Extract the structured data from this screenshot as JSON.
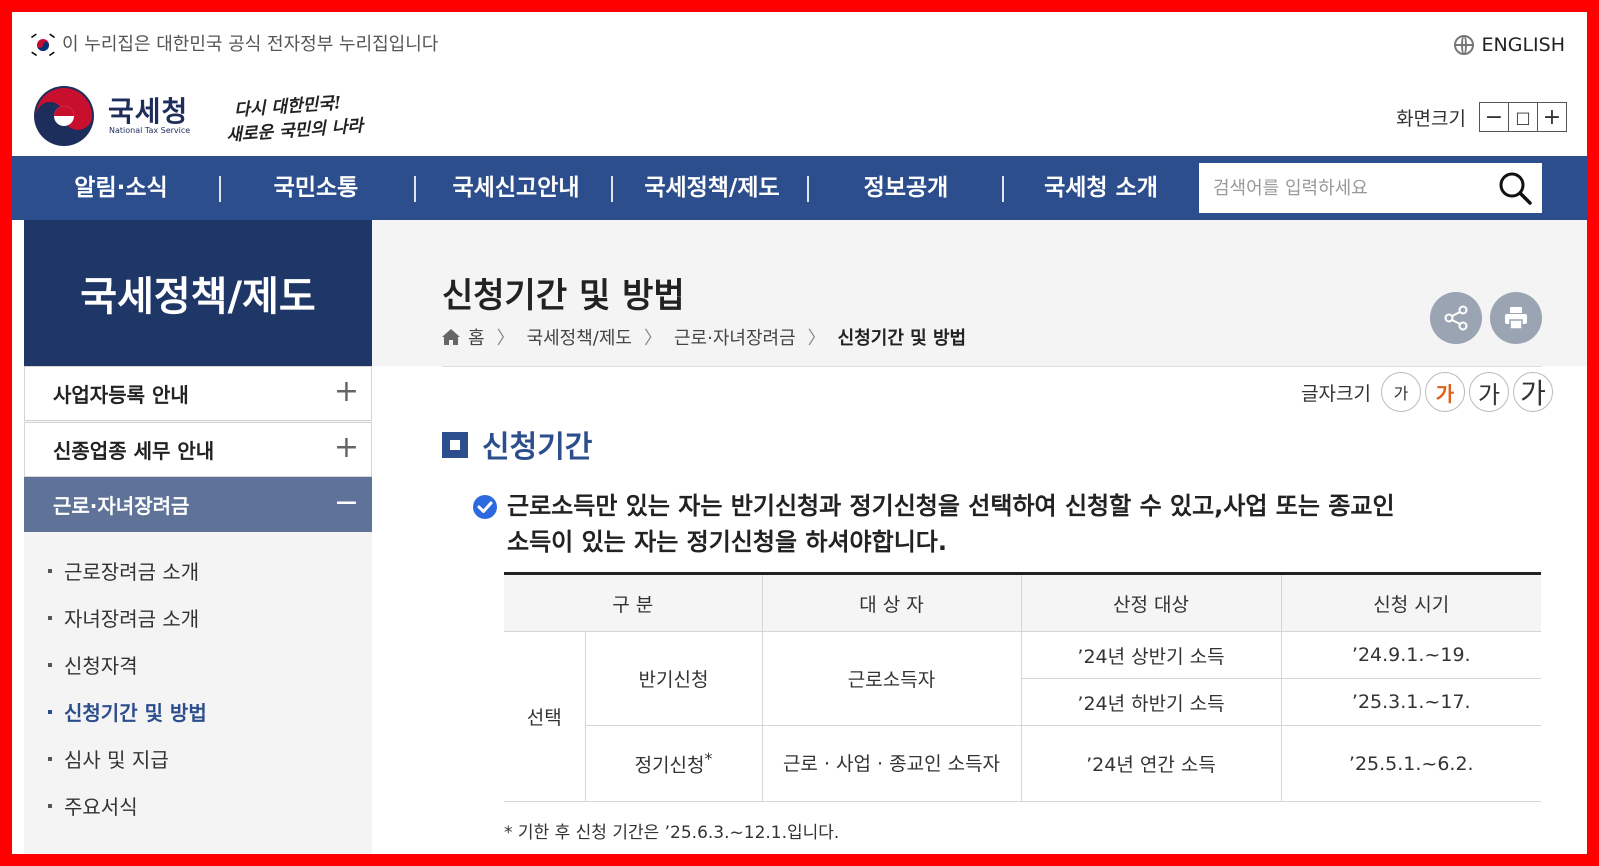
{
  "gov_banner": {
    "text": "이 누리집은 대한민국 공식 전자정부 누리집입니다",
    "lang_label": "ENGLISH"
  },
  "logo": {
    "name_ko": "국세청",
    "name_en": "National Tax Service",
    "slogan_line1": "다시 대한민국!",
    "slogan_line2": "새로운 국민의 나라"
  },
  "zoom": {
    "label": "화면크기",
    "minus": "−",
    "reset": "□",
    "plus": "+"
  },
  "nav": {
    "items": [
      "알림·소식",
      "국민소통",
      "국세신고안내",
      "국세정책/제도",
      "정보공개",
      "국세청 소개"
    ],
    "search_placeholder": "검색어를 입력하세요"
  },
  "sidebar": {
    "title": "국세정책/제도",
    "items": [
      {
        "label": "사업자등록 안내",
        "toggle": "+"
      },
      {
        "label": "신종업종 세무 안내",
        "toggle": "+"
      },
      {
        "label": "근로·자녀장려금",
        "toggle": "−"
      }
    ],
    "sub_items": [
      "근로장려금 소개",
      "자녀장려금 소개",
      "신청자격",
      "신청기간 및 방법",
      "심사 및 지급",
      "주요서식"
    ]
  },
  "page": {
    "title": "신청기간 및 방법",
    "breadcrumb": [
      "홈",
      "국세정책/제도",
      "근로·자녀장려금",
      "신청기간 및 방법"
    ]
  },
  "font_size": {
    "label": "글자크기",
    "options": [
      "가",
      "가",
      "가",
      "가"
    ]
  },
  "section": {
    "title": "신청기간",
    "desc_line1": "근로소득만 있는 자는 반기신청과 정기신청을 선택하여 신청할 수 있고,사업 또는 종교인",
    "desc_line2": "소득이 있는 자는 정기신청을 하셔야합니다."
  },
  "table": {
    "headers": [
      "구 분",
      "대 상 자",
      "산정 대상",
      "신청 시기"
    ],
    "group": "선택",
    "row1_type": "반기신청",
    "row1_target": "근로소득자",
    "row1a_basis": "’24년 상반기 소득",
    "row1a_period": "’24.9.1.~19.",
    "row1b_basis": "’24년 하반기 소득",
    "row1b_period": "’25.3.1.~17.",
    "row2_type": "정기신청",
    "row2_type_sup": "*",
    "row2_target": "근로 · 사업 · 종교인 소득자",
    "row2_basis": "’24년 연간 소득",
    "row2_period": "’25.5.1.~6.2."
  },
  "note": "* 기한 후 신청 기간은 ’25.6.3.~12.1.입니다.",
  "colors": {
    "nav_bg": "#2d4e8c",
    "side_title_bg": "#1f3767",
    "active_menu_bg": "#5e7397",
    "accent_orange": "#e0611b"
  }
}
